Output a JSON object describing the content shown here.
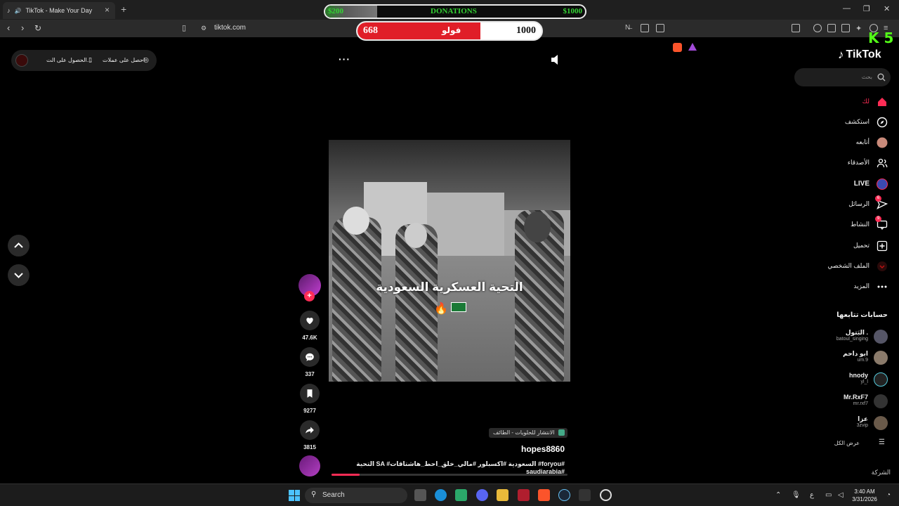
{
  "browser": {
    "tab_title": "TikTok - Make Your Day",
    "url": "tiktok.com"
  },
  "overlay": {
    "donations": {
      "left": "$200",
      "center": "DONATIONS",
      "right": "$1000",
      "progress_fraction": 0.2
    },
    "follow": {
      "current": "668",
      "label": "فولو",
      "goal": "1000",
      "progress_fraction": 0.668
    },
    "kick_badge": "K 5"
  },
  "promo": {
    "get_coins": "احصل على عملات",
    "get_app": "الحصول على الت..."
  },
  "video": {
    "caption": "التحية العسكرية السعودية",
    "caption_emoji": "🔥",
    "progress_fraction": 0.12
  },
  "actions": {
    "likes": "47.6K",
    "comments": "337",
    "saves": "9277",
    "shares": "3815"
  },
  "meta": {
    "tag": "الانتشار للحلويات - الطائف",
    "username": "hopes8860",
    "description": "التحية SA #السعودية #اكسبلور #مالي_خلق_احط_هاشتاقات #foryou# saudiarabia#"
  },
  "sidebar": {
    "logo": "TikTok",
    "search_placeholder": "بحث",
    "nav": [
      {
        "label": "لك",
        "icon": "home-icon",
        "active": true
      },
      {
        "label": "استكشف",
        "icon": "compass-icon"
      },
      {
        "label": "أتابعه",
        "icon": "following-avatar-icon"
      },
      {
        "label": "الأصدقاء",
        "icon": "friends-icon"
      },
      {
        "label": "LIVE",
        "icon": "live-icon"
      },
      {
        "label": "الرسائل",
        "icon": "messages-icon",
        "badge": "6"
      },
      {
        "label": "النشاط",
        "icon": "activity-icon",
        "badge": "9"
      },
      {
        "label": "تحميل",
        "icon": "upload-icon"
      },
      {
        "label": "الملف الشخصي",
        "icon": "profile-icon"
      },
      {
        "label": "المزيد",
        "icon": "more-icon"
      }
    ],
    "following_title": "حسابات تتابعها",
    "accounts": [
      {
        "name": "البَتول .",
        "handle": "batoul_singing"
      },
      {
        "name": "ابو داحم",
        "handle": "um.9"
      },
      {
        "name": "hnody",
        "handle": "yl_l"
      },
      {
        "name": "Mr.RxF7",
        "handle": "mr.rxf7"
      },
      {
        "name": "عزا",
        "handle": "3zvip"
      }
    ],
    "see_all": "عرض الكل",
    "company": "الشركة"
  },
  "taskbar": {
    "search_placeholder": "Search",
    "time": "3:40 AM",
    "date": "3/31/2026",
    "lang": "ع"
  }
}
